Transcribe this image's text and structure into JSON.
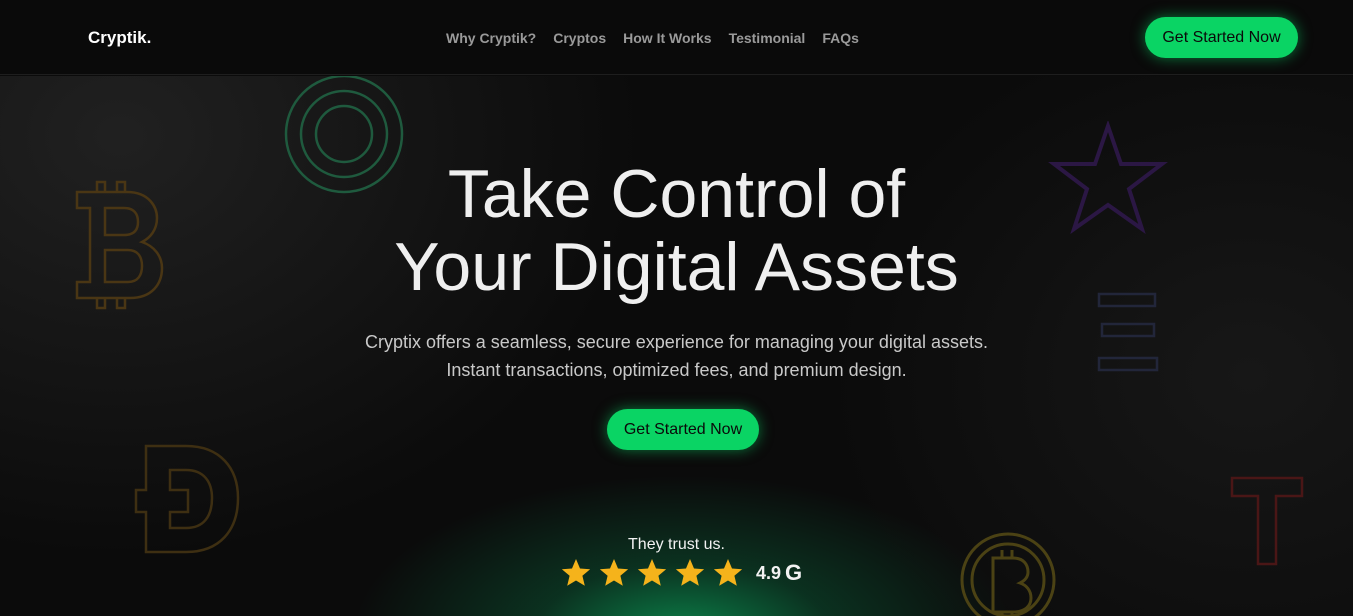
{
  "nav": {
    "brand": "Cryptik.",
    "links": [
      "Why Cryptik?",
      "Cryptos",
      "How It Works",
      "Testimonial",
      "FAQs"
    ],
    "cta": "Get Started Now"
  },
  "hero": {
    "title_line1": "Take Control of",
    "title_line2": "Your Digital Assets",
    "subtitle_line1": "Cryptix offers a seamless, secure experience for managing your digital assets.",
    "subtitle_line2": "Instant transactions, optimized fees, and premium design.",
    "cta": "Get Started Now",
    "trust_label": "They trust us.",
    "rating_value": "4.9",
    "rating_stars": 5,
    "rating_source_icon": "google-icon"
  },
  "colors": {
    "accent": "#0ad464",
    "star": "#f5b31b",
    "background": "#0b0b0b"
  },
  "decorations": [
    "target-circles-icon",
    "bitcoin-icon",
    "star-outline-icon",
    "lines-icon",
    "dogecoin-icon",
    "tether-icon",
    "bitcoin-coin-icon"
  ]
}
